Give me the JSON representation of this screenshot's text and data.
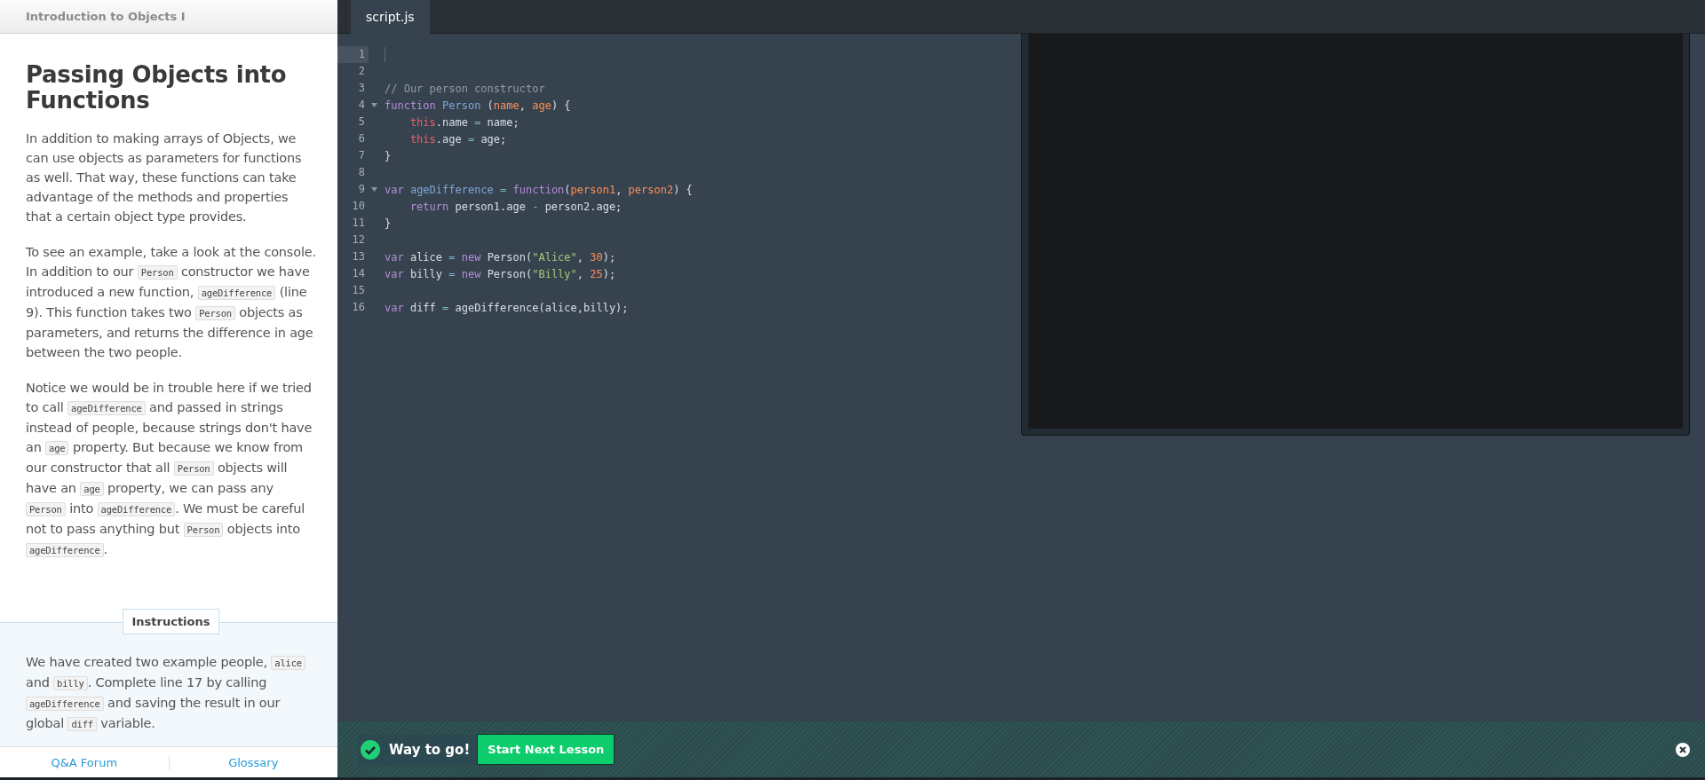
{
  "lesson": {
    "course_title": "Introduction to Objects I",
    "title": "Passing Objects into Functions",
    "paragraphs": [
      [
        {
          "kind": "text",
          "text": "In addition to making arrays of Objects, we can use objects as parameters for functions as well. That way, these functions can take advantage of the methods and properties that a certain object type provides."
        }
      ],
      [
        {
          "kind": "text",
          "text": "To see an example, take a look at the console. In addition to our "
        },
        {
          "kind": "code",
          "text": "Person"
        },
        {
          "kind": "text",
          "text": " constructor we have introduced a new function, "
        },
        {
          "kind": "code",
          "text": "ageDifference"
        },
        {
          "kind": "text",
          "text": " (line 9). This function takes two "
        },
        {
          "kind": "code",
          "text": "Person"
        },
        {
          "kind": "text",
          "text": " objects as parameters, and returns the difference in age between the two people."
        }
      ],
      [
        {
          "kind": "text",
          "text": "Notice we would be in trouble here if we tried to call "
        },
        {
          "kind": "code",
          "text": "ageDifference"
        },
        {
          "kind": "text",
          "text": " and passed in strings instead of people, because strings don't have an "
        },
        {
          "kind": "code",
          "text": "age"
        },
        {
          "kind": "text",
          "text": " property. But because we know from our constructor that all "
        },
        {
          "kind": "code",
          "text": "Person"
        },
        {
          "kind": "text",
          "text": " objects will have an "
        },
        {
          "kind": "code",
          "text": "age"
        },
        {
          "kind": "text",
          "text": " property, we can pass any "
        },
        {
          "kind": "code",
          "text": "Person"
        },
        {
          "kind": "text",
          "text": " into "
        },
        {
          "kind": "code",
          "text": "ageDifference"
        },
        {
          "kind": "text",
          "text": ". We must be careful not to pass anything but "
        },
        {
          "kind": "code",
          "text": "Person"
        },
        {
          "kind": "text",
          "text": " objects into "
        },
        {
          "kind": "code",
          "text": "ageDifference"
        },
        {
          "kind": "text",
          "text": "."
        }
      ]
    ],
    "instructions": {
      "label": "Instructions",
      "text": [
        {
          "kind": "text",
          "text": "We have created two example people, "
        },
        {
          "kind": "code",
          "text": "alice"
        },
        {
          "kind": "text",
          "text": " and "
        },
        {
          "kind": "code",
          "text": "billy"
        },
        {
          "kind": "text",
          "text": ". Complete line 17 by calling "
        },
        {
          "kind": "code",
          "text": "ageDifference"
        },
        {
          "kind": "text",
          "text": " and saving the result in our global "
        },
        {
          "kind": "code",
          "text": "diff"
        },
        {
          "kind": "text",
          "text": " variable."
        }
      ]
    },
    "footer_links": [
      "Q&A Forum",
      "Glossary"
    ]
  },
  "editor": {
    "tabs": [
      {
        "label": "script.js",
        "selected": true
      }
    ],
    "lines": [
      {
        "number": "1",
        "active": true,
        "fold": false
      },
      {
        "number": "2",
        "active": false,
        "fold": false
      },
      {
        "number": "3",
        "active": false,
        "fold": false,
        "tokens": [
          {
            "kind": "comment",
            "text": "// Our person constructor"
          }
        ]
      },
      {
        "number": "4",
        "active": false,
        "fold": true,
        "tokens": [
          {
            "kind": "keyword",
            "text": "function"
          },
          {
            "kind": "def",
            "text": " Person"
          },
          {
            "kind": "plain",
            "text": " ("
          },
          {
            "kind": "param",
            "text": "name"
          },
          {
            "kind": "plain",
            "text": ", "
          },
          {
            "kind": "param",
            "text": "age"
          },
          {
            "kind": "plain",
            "text": ") {"
          }
        ]
      },
      {
        "number": "5",
        "active": false,
        "fold": false,
        "tokens": [
          {
            "kind": "this",
            "text": "    this"
          },
          {
            "kind": "plain",
            "text": ".name "
          },
          {
            "kind": "op",
            "text": "="
          },
          {
            "kind": "plain",
            "text": " name;"
          }
        ]
      },
      {
        "number": "6",
        "active": false,
        "fold": false,
        "tokens": [
          {
            "kind": "this",
            "text": "    this"
          },
          {
            "kind": "plain",
            "text": ".age "
          },
          {
            "kind": "op",
            "text": "="
          },
          {
            "kind": "plain",
            "text": " age;"
          }
        ]
      },
      {
        "number": "7",
        "active": false,
        "fold": false,
        "tokens": [
          {
            "kind": "plain",
            "text": "}"
          }
        ]
      },
      {
        "number": "8",
        "active": false,
        "fold": false
      },
      {
        "number": "9",
        "active": false,
        "fold": true,
        "tokens": [
          {
            "kind": "keyword",
            "text": "var"
          },
          {
            "kind": "def",
            "text": " ageDifference"
          },
          {
            "kind": "op",
            "text": " = "
          },
          {
            "kind": "keyword",
            "text": "function"
          },
          {
            "kind": "plain",
            "text": "("
          },
          {
            "kind": "param",
            "text": "person1"
          },
          {
            "kind": "plain",
            "text": ", "
          },
          {
            "kind": "param",
            "text": "person2"
          },
          {
            "kind": "plain",
            "text": ") {"
          }
        ]
      },
      {
        "number": "10",
        "active": false,
        "fold": false,
        "tokens": [
          {
            "kind": "keyword",
            "text": "    return"
          },
          {
            "kind": "plain",
            "text": " person1.age "
          },
          {
            "kind": "op",
            "text": "-"
          },
          {
            "kind": "plain",
            "text": " person2.age;"
          }
        ]
      },
      {
        "number": "11",
        "active": false,
        "fold": false,
        "tokens": [
          {
            "kind": "plain",
            "text": "}"
          }
        ]
      },
      {
        "number": "12",
        "active": false,
        "fold": false
      },
      {
        "number": "13",
        "active": false,
        "fold": false,
        "tokens": [
          {
            "kind": "keyword",
            "text": "var"
          },
          {
            "kind": "plain",
            "text": " alice "
          },
          {
            "kind": "op",
            "text": "="
          },
          {
            "kind": "keyword",
            "text": " new"
          },
          {
            "kind": "plain",
            "text": " Person("
          },
          {
            "kind": "string",
            "text": "\"Alice\""
          },
          {
            "kind": "plain",
            "text": ", "
          },
          {
            "kind": "number",
            "text": "30"
          },
          {
            "kind": "plain",
            "text": ");"
          }
        ]
      },
      {
        "number": "14",
        "active": false,
        "fold": false,
        "tokens": [
          {
            "kind": "keyword",
            "text": "var"
          },
          {
            "kind": "plain",
            "text": " billy "
          },
          {
            "kind": "op",
            "text": "="
          },
          {
            "kind": "keyword",
            "text": " new"
          },
          {
            "kind": "plain",
            "text": " Person("
          },
          {
            "kind": "string",
            "text": "\"Billy\""
          },
          {
            "kind": "plain",
            "text": ", "
          },
          {
            "kind": "number",
            "text": "25"
          },
          {
            "kind": "plain",
            "text": ");"
          }
        ]
      },
      {
        "number": "15",
        "active": false,
        "fold": false
      },
      {
        "number": "16",
        "active": false,
        "fold": false,
        "tokens": [
          {
            "kind": "keyword",
            "text": "var"
          },
          {
            "kind": "plain",
            "text": " diff "
          },
          {
            "kind": "op",
            "text": "="
          },
          {
            "kind": "plain",
            "text": " ageDifference(alice,billy);"
          }
        ]
      }
    ]
  },
  "success_bar": {
    "message": "Way to go!",
    "button": "Start Next Lesson"
  }
}
